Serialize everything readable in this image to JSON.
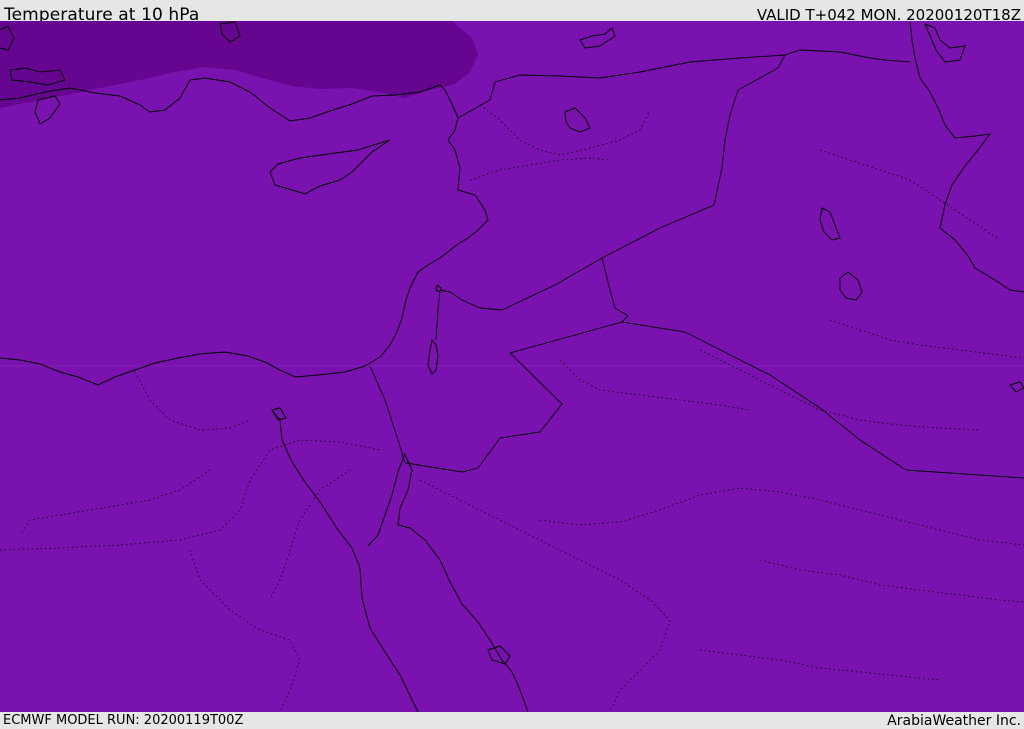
{
  "header": {
    "title": "Temperature at 10 hPa",
    "valid_time": "VALID T+042 MON. 20200120T18Z"
  },
  "footer": {
    "model_run": "ECMWF MODEL RUN: 20200119T00Z",
    "credit": "ArabiaWeather Inc."
  },
  "map": {
    "field": "Temperature",
    "level": "10 hPa",
    "colors": {
      "main_fill": "#7a12b0",
      "cold_band": "#66058f",
      "border": "#000000"
    }
  }
}
